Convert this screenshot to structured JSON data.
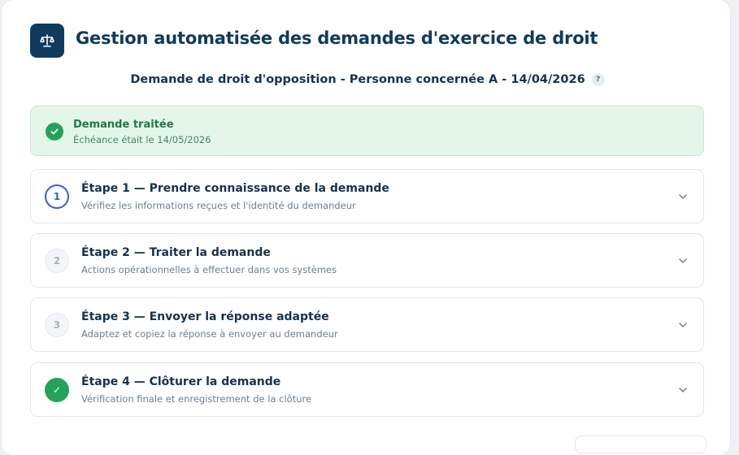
{
  "header": {
    "title": "Gestion automatisée des demandes d'exercice de droit",
    "logo_icon": "balance-scale-icon"
  },
  "request": {
    "subtitle": "Demande de droit d'opposition - Personne concernée A - 14/04/2026",
    "help_label": "?"
  },
  "status": {
    "icon": "check-circle-icon",
    "title": "Demande traitée",
    "subtitle": "Échéance était le 14/05/2026",
    "color": "#22a35a"
  },
  "steps": [
    {
      "number": "1",
      "state": "active",
      "title": "Étape 1 — Prendre connaissance de la demande",
      "subtitle": "Vérifiez les informations reçues et l'identité du demandeur"
    },
    {
      "number": "2",
      "state": "pending",
      "title": "Étape 2 — Traiter la demande",
      "subtitle": "Actions opérationnelles à effectuer dans vos systèmes"
    },
    {
      "number": "3",
      "state": "pending",
      "title": "Étape 3 — Envoyer la réponse adaptée",
      "subtitle": "Adaptez et copiez la réponse à envoyer au demandeur"
    },
    {
      "number": "✓",
      "state": "done",
      "title": "Étape 4 — Clôturer la demande",
      "subtitle": "Vérification finale et enregistrement de la clôture"
    }
  ],
  "colors": {
    "brand": "#0e3b5c",
    "accent_active": "#2e63dc",
    "success": "#22a35a",
    "success_bg": "#e4f6ea"
  }
}
